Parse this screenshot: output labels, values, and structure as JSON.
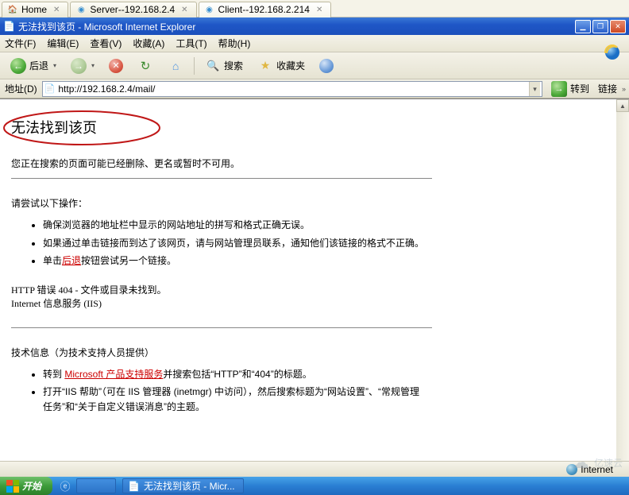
{
  "wintabs": [
    {
      "label": "Home",
      "icon": "home"
    },
    {
      "label": "Server--192.168.2.4",
      "icon": "node"
    },
    {
      "label": "Client--192.168.2.214",
      "icon": "node"
    }
  ],
  "title": "无法找到该页 - Microsoft Internet Explorer",
  "menu": {
    "file": "文件(F)",
    "edit": "编辑(E)",
    "view": "查看(V)",
    "fav": "收藏(A)",
    "tools": "工具(T)",
    "help": "帮助(H)"
  },
  "toolbar": {
    "back": "后退",
    "search": "搜索",
    "favorites": "收藏夹"
  },
  "addressbar": {
    "label": "地址(D)",
    "url": "http://192.168.2.4/mail/",
    "go": "转到",
    "links": "链接"
  },
  "page": {
    "h1": "无法找到该页",
    "sub": "您正在搜索的页面可能已经删除、更名或暂时不可用。",
    "tryHeader": "请尝试以下操作：",
    "bullets": [
      "确保浏览器的地址栏中显示的网站地址的拼写和格式正确无误。",
      "如果通过单击链接而到达了该网页，请与网站管理员联系，通知他们该链接的格式不正确。",
      "单击"
    ],
    "backlink": "后退",
    "bullet3tail": "按钮尝试另一个链接。",
    "err1": "HTTP 错误 404 - 文件或目录未找到。",
    "err2": "Internet 信息服务 (IIS)",
    "techHeader": "技术信息（为技术支持人员提供）",
    "tb1a": "转到 ",
    "mslink": "Microsoft 产品支持服务",
    "tb1b": "并搜索包括“HTTP”和“404”的标题。",
    "tb2": "打开“IIS 帮助”（可在 IIS 管理器 (inetmgr) 中访问），然后搜索标题为“网站设置”、“常规管理任务”和“关于自定义错误消息”的主题。"
  },
  "status": {
    "zone": "Internet"
  },
  "taskbar": {
    "start": "开始",
    "task": "无法找到该页 - Micr..."
  },
  "watermark": "亿速云"
}
